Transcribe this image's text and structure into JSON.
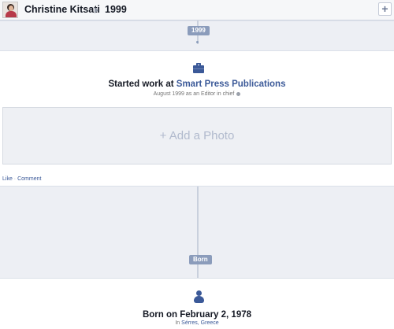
{
  "header": {
    "owner_name": "Christine Kitsati",
    "current_year": "1999",
    "add_label": "+"
  },
  "timeline": {
    "year_marker": "1999",
    "born_marker": "Born"
  },
  "work_story": {
    "icon": "briefcase-icon",
    "title_prefix": "Started work at ",
    "company": "Smart Press Publications",
    "subtitle": "August 1999 as an Editor in chief",
    "privacy_icon": "globe-icon",
    "add_photo_label": "+ Add a Photo",
    "like_label": "Like",
    "separator": " · ",
    "comment_label": "Comment"
  },
  "born_story": {
    "icon": "baby-icon",
    "title": "Born on February 2, 1978",
    "location_prefix": "In ",
    "location": "Sérres, Greece"
  },
  "colors": {
    "link": "#3b5998",
    "band": "#edeff4",
    "marker": "#8b9cbb"
  }
}
